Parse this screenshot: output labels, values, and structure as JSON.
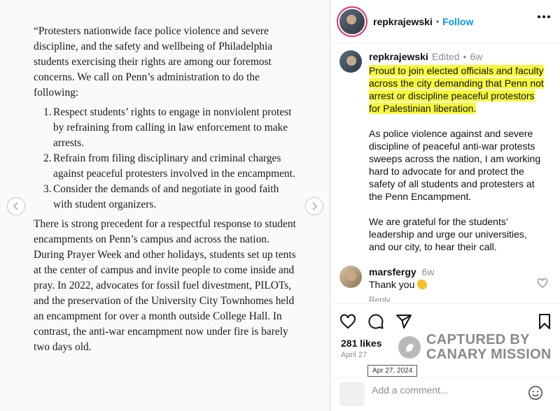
{
  "document": {
    "intro": "“Protesters nationwide face police violence and severe discipline, and the safety and wellbeing of Philadelphia students exercising their rights are among our foremost concerns. We call on Penn’s administration to do the following:",
    "items": [
      {
        "num": "1.",
        "text": "Respect students’ rights to engage in nonviolent protest by refraining from calling in law enforcement to make arrests."
      },
      {
        "num": "2.",
        "text": "Refrain from filing disciplinary and criminal charges against peaceful protesters involved in the encampment."
      },
      {
        "num": "3.",
        "text": "Consider the demands of and negotiate in good faith with student organizers."
      }
    ],
    "body": "There is strong precedent for a respectful response to student encampments on Penn’s campus and across the nation. During Prayer Week and other holidays, students set up tents at the center of campus and invite people to come inside and pray. In 2022, advocates for fossil fuel divestment, PILOTs, and the preservation of the University City Townhomes held an encampment for over a month outside College Hall. In contrast, the anti-war encampment now under fire is barely two days old."
  },
  "header": {
    "username": "repkrajewski",
    "separator": "•",
    "follow_label": "Follow"
  },
  "caption": {
    "username": "repkrajewski",
    "edited": "Edited",
    "separator": "•",
    "age": "6w",
    "highlighted": "Proud to join elected officials and faculty across the city demanding that Penn not arrest or discipline peaceful protestors for Palestinian liberation.",
    "paragraph2": "As police violence against and severe discipline of peaceful anti-war protests sweeps across the nation, I am working hard to advocate for and protect the safety of all students and protesters at the Penn Encampment.",
    "paragraph3": "We are grateful for the students’ leadership and urge our universities, and our city, to hear their call."
  },
  "comment": {
    "username": "marsfergy",
    "age": "6w",
    "text": "Thank you",
    "emoji_icon": "clapping-hands-icon",
    "reply_label": "Reply"
  },
  "post": {
    "likes": "281 likes",
    "date": "April 27",
    "date_tooltip": "Apr 27, 2024"
  },
  "watermark": {
    "line1": "CAPTURED BY",
    "line2": "CANARY MISSION"
  },
  "add_comment": {
    "placeholder": "Add a comment..."
  },
  "colors": {
    "follow": "#0095f6",
    "highlight": "#f6f93a",
    "muted": "#8e8e8e"
  }
}
